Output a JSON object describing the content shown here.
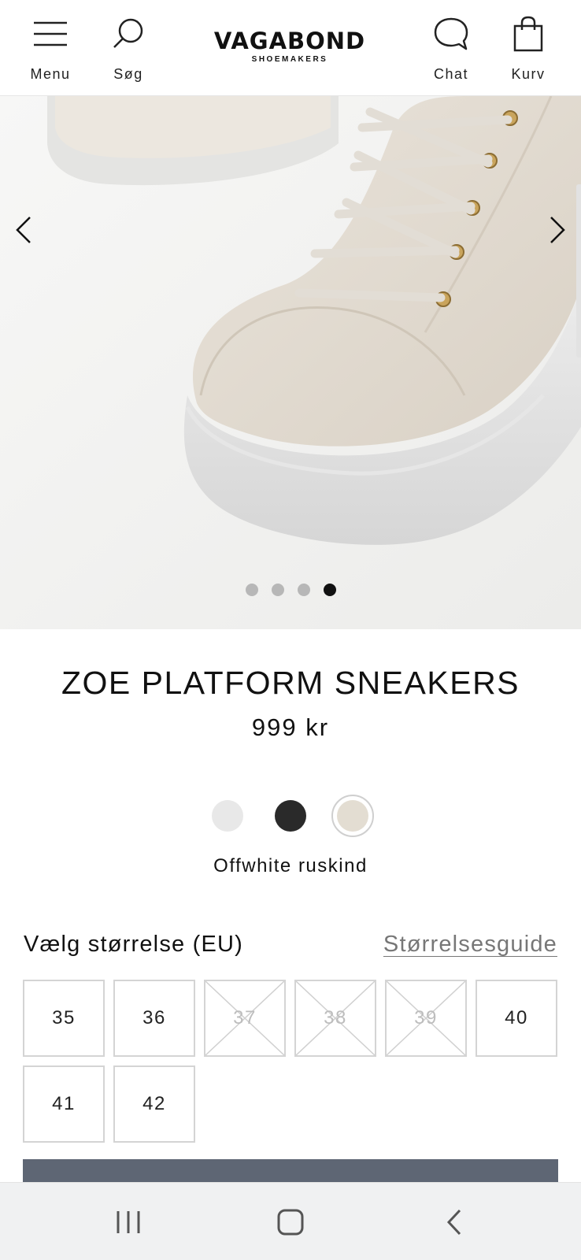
{
  "header": {
    "menu_label": "Menu",
    "search_label": "Søg",
    "logo_brand": "VAGABOND",
    "logo_sub": "SHOEMAKERS",
    "chat_label": "Chat",
    "cart_label": "Kurv"
  },
  "gallery": {
    "image_count": 4,
    "active_index": 4
  },
  "product": {
    "title": "ZOE PLATFORM SNEAKERS",
    "price": "999 kr",
    "colors": [
      {
        "hex": "#e8e8e8",
        "selected": false
      },
      {
        "hex": "#2a2a2a",
        "selected": false
      },
      {
        "hex": "#e3ddd2",
        "selected": true
      }
    ],
    "selected_color_name": "Offwhite ruskind"
  },
  "sizes": {
    "label": "Vælg størrelse (EU)",
    "guide_link": "Størrelsesguide",
    "options": [
      {
        "value": "35",
        "available": true
      },
      {
        "value": "36",
        "available": true
      },
      {
        "value": "37",
        "available": false
      },
      {
        "value": "38",
        "available": false
      },
      {
        "value": "39",
        "available": false
      },
      {
        "value": "40",
        "available": true
      },
      {
        "value": "41",
        "available": true
      },
      {
        "value": "42",
        "available": true
      }
    ]
  },
  "colors": {
    "cta_bg": "#5e6674",
    "text": "#111111",
    "muted": "#777777"
  }
}
